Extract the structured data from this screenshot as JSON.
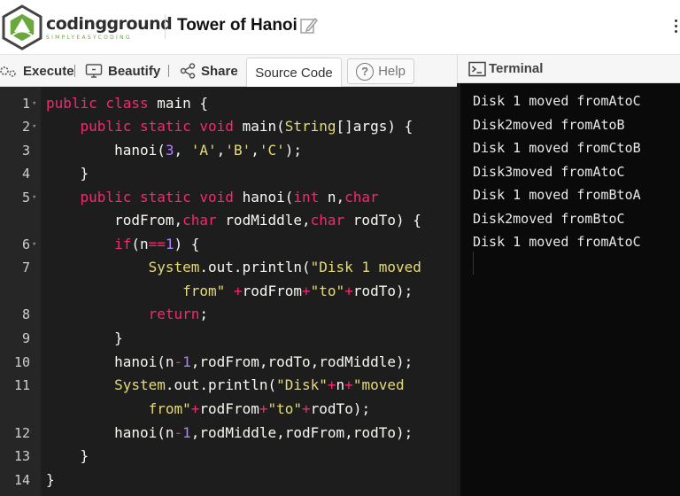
{
  "header": {
    "brand_name": "codingground",
    "brand_tagline": "SIMPLYEASYCODING",
    "project_title": "Tower of Hanoi"
  },
  "toolbar": {
    "execute_label": "Execute",
    "beautify_label": "Beautify",
    "share_label": "Share",
    "source_code_tab": "Source Code",
    "help_label": "Help"
  },
  "terminal": {
    "title": "Terminal",
    "output": [
      "Disk 1 moved fromAtoC",
      "Disk2moved fromAtoB",
      "Disk 1 moved fromCtoB",
      "Disk3moved fromAtoC",
      "Disk 1 moved fromBtoA",
      "Disk2moved fromBtoC",
      "Disk 1 moved fromAtoC"
    ]
  },
  "editor": {
    "line_numbers": [
      "1",
      "2",
      "3",
      "4",
      "5",
      "6",
      "7",
      "8",
      "9",
      "10",
      "11",
      "12",
      "13",
      "14"
    ],
    "lines": [
      {
        "n": "1",
        "fold": true,
        "segs": [
          [
            "kw",
            "public class "
          ],
          [
            "pl",
            "main {"
          ]
        ]
      },
      {
        "n": "2",
        "fold": true,
        "segs": [
          [
            "pl",
            "    "
          ],
          [
            "kw",
            "public static void "
          ],
          [
            "pl",
            "main("
          ],
          [
            "cl",
            "String"
          ],
          [
            "pl",
            "[]args) {"
          ]
        ]
      },
      {
        "n": "3",
        "fold": false,
        "segs": [
          [
            "pl",
            "        hanoi("
          ],
          [
            "nm",
            "3"
          ],
          [
            "pl",
            ", "
          ],
          [
            "st",
            "'A'"
          ],
          [
            "pl",
            ","
          ],
          [
            "st",
            "'B'"
          ],
          [
            "pl",
            ","
          ],
          [
            "st",
            "'C'"
          ],
          [
            "pl",
            ");"
          ]
        ]
      },
      {
        "n": "4",
        "fold": false,
        "segs": [
          [
            "pl",
            "    }"
          ]
        ]
      },
      {
        "n": "5",
        "fold": true,
        "segs": [
          [
            "pl",
            "    "
          ],
          [
            "kw",
            "public static void "
          ],
          [
            "pl",
            "hanoi("
          ],
          [
            "kw",
            "int "
          ],
          [
            "pl",
            "n,"
          ],
          [
            "kw",
            "char"
          ]
        ]
      },
      {
        "n": "",
        "fold": false,
        "segs": [
          [
            "pl",
            "        rodFrom,"
          ],
          [
            "kw",
            "char "
          ],
          [
            "pl",
            "rodMiddle,"
          ],
          [
            "kw",
            "char "
          ],
          [
            "pl",
            "rodTo) {"
          ]
        ]
      },
      {
        "n": "6",
        "fold": true,
        "segs": [
          [
            "pl",
            "        "
          ],
          [
            "kw",
            "if"
          ],
          [
            "pl",
            "(n"
          ],
          [
            "kw",
            "=="
          ],
          [
            "nm",
            "1"
          ],
          [
            "pl",
            ") {"
          ]
        ]
      },
      {
        "n": "7",
        "fold": false,
        "segs": [
          [
            "pl",
            "            "
          ],
          [
            "cl",
            "System"
          ],
          [
            "pl",
            ".out.println("
          ],
          [
            "st",
            "\"Disk 1 moved"
          ]
        ]
      },
      {
        "n": "",
        "fold": false,
        "segs": [
          [
            "st",
            "                from\""
          ],
          [
            "pl",
            " "
          ],
          [
            "kw",
            "+"
          ],
          [
            "pl",
            "rodFrom"
          ],
          [
            "kw",
            "+"
          ],
          [
            "st",
            "\"to\""
          ],
          [
            "kw",
            "+"
          ],
          [
            "pl",
            "rodTo);"
          ]
        ]
      },
      {
        "n": "8",
        "fold": false,
        "segs": [
          [
            "pl",
            "            "
          ],
          [
            "kw",
            "return"
          ],
          [
            "pl",
            ";"
          ]
        ]
      },
      {
        "n": "9",
        "fold": false,
        "segs": [
          [
            "pl",
            "        }"
          ]
        ]
      },
      {
        "n": "10",
        "fold": false,
        "segs": [
          [
            "pl",
            "        hanoi(n"
          ],
          [
            "kw",
            "-"
          ],
          [
            "nm",
            "1"
          ],
          [
            "pl",
            ",rodFrom,rodTo,rodMiddle);"
          ]
        ]
      },
      {
        "n": "11",
        "fold": false,
        "segs": [
          [
            "pl",
            "        "
          ],
          [
            "cl",
            "System"
          ],
          [
            "pl",
            ".out.println("
          ],
          [
            "st",
            "\"Disk\""
          ],
          [
            "kw",
            "+"
          ],
          [
            "pl",
            "n"
          ],
          [
            "kw",
            "+"
          ],
          [
            "st",
            "\"moved"
          ]
        ]
      },
      {
        "n": "",
        "fold": false,
        "segs": [
          [
            "st",
            "            from\""
          ],
          [
            "kw",
            "+"
          ],
          [
            "pl",
            "rodFrom"
          ],
          [
            "kw",
            "+"
          ],
          [
            "st",
            "\"to\""
          ],
          [
            "kw",
            "+"
          ],
          [
            "pl",
            "rodTo);"
          ]
        ]
      },
      {
        "n": "12",
        "fold": false,
        "segs": [
          [
            "pl",
            "        hanoi(n"
          ],
          [
            "kw",
            "-"
          ],
          [
            "nm",
            "1"
          ],
          [
            "pl",
            ",rodMiddle,rodFrom,rodTo);"
          ]
        ]
      },
      {
        "n": "13",
        "fold": false,
        "segs": [
          [
            "pl",
            "    }"
          ]
        ]
      },
      {
        "n": "14",
        "fold": false,
        "segs": [
          [
            "pl",
            "}"
          ]
        ]
      }
    ]
  },
  "colors": {
    "editor_bg": "#1d1d1d",
    "terminal_bg": "#0a0a0a",
    "keyword": "#f92672",
    "string": "#e6db74",
    "number": "#ae81ff",
    "brand_green": "#6aa83c"
  },
  "icons": [
    "codingground-logo-icon",
    "edit-icon",
    "execute-icon",
    "beautify-icon",
    "share-icon",
    "help-icon",
    "terminal-icon",
    "fold-arrow-icon"
  ]
}
